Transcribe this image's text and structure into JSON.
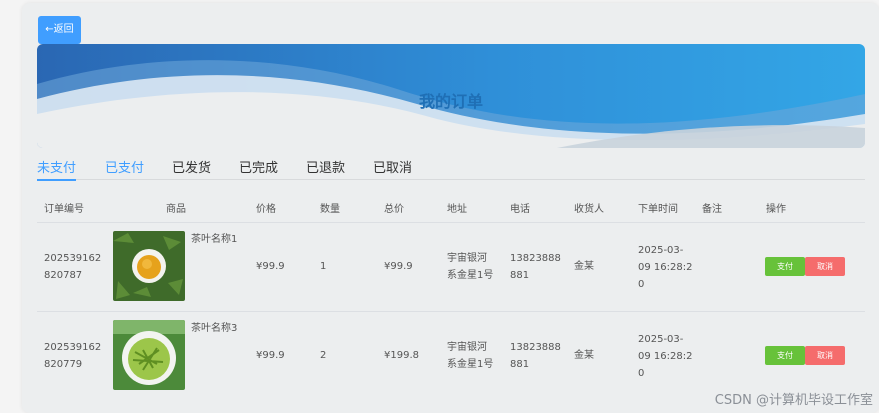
{
  "back_button": {
    "label": "←返回"
  },
  "banner": {
    "title": "我的订单"
  },
  "tabs": [
    "未支付",
    "已支付",
    "已发货",
    "已完成",
    "已退款",
    "已取消"
  ],
  "table": {
    "headers": [
      "订单编号",
      "商品",
      "价格",
      "数量",
      "总价",
      "地址",
      "电话",
      "收货人",
      "下单时间",
      "备注",
      "操作"
    ],
    "rows": [
      {
        "order_no_1": "202539162",
        "order_no_2": "820787",
        "product_name": "茶叶名称1",
        "price": "¥99.9",
        "qty": "1",
        "total": "¥99.9",
        "address_1": "宇宙银河",
        "address_2": "系金星1号",
        "phone_1": "13823888",
        "phone_2": "881",
        "receiver": "金某",
        "time_1": "2025-03-",
        "time_2": "09 16:28:2",
        "time_3": "0",
        "remark": "",
        "pay_label": "支付",
        "cancel_label": "取消"
      },
      {
        "order_no_1": "202539162",
        "order_no_2": "820779",
        "product_name": "茶叶名称3",
        "price": "¥99.9",
        "qty": "2",
        "total": "¥199.8",
        "address_1": "宇宙银河",
        "address_2": "系金星1号",
        "phone_1": "13823888",
        "phone_2": "881",
        "receiver": "金某",
        "time_1": "2025-03-",
        "time_2": "09 16:28:2",
        "time_3": "0",
        "remark": "",
        "pay_label": "支付",
        "cancel_label": "取消"
      }
    ]
  },
  "watermark": "CSDN @计算机毕设工作室",
  "colors": {
    "primary": "#409eff",
    "pay": "#67c23a",
    "cancel": "#f56c6c",
    "banner": "#1f6fb5"
  }
}
